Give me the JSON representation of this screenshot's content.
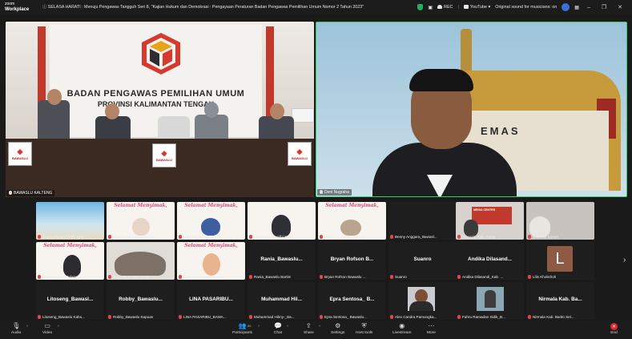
{
  "app": {
    "logo_line1": "zoom",
    "logo_line2": "Workplace"
  },
  "meeting": {
    "title": "SELASA HARATI : Menuju Pengawas Tangguh Seri 8, \"Kajian Hukum dan Demokrasi : Pengayaan Peraturan Badan Pengawas Pemilihan Umum Nomor 2 Tahun 2023\""
  },
  "status": {
    "rec": "REC",
    "youtube": "YouTube",
    "sound": "Original sound for musicians: on"
  },
  "colors": {
    "active_speaker": "#2fd36a",
    "end": "#e02828",
    "muted_mic": "#e04848"
  },
  "main": {
    "left_name": "BAWASLU KALTENG",
    "left_banner_line1": "BADAN PENGAWAS PEMILIHAN UMUM",
    "left_banner_line2": "PROVINSI KALIMANTAN TENGAH",
    "sign_label": "BAWASLU",
    "right_name": "Deni Nugraha",
    "right_sign": "EMAS"
  },
  "gallery": {
    "selamat_text": "Selamat Menyimak,",
    "row1": [
      {
        "name": "Satria BWSLU KAB. KPS"
      },
      {
        "name": "Misbah_Bws Kab. Barlim"
      },
      {
        "name": "B&S_BWS MURA"
      },
      {
        "name": "Bws Barsel_Ledhi Stan..."
      },
      {
        "name": "Terigo_Staf Bawaslu Ka..."
      },
      {
        "name": "Benny Anggara_Bawasl..."
      },
      {
        "name": "Bawaslu Kab. Kobar"
      },
      {
        "name": "Bawaslu Barsel"
      }
    ],
    "row2": [
      {
        "name": "Bawaslu Kota Palangka..."
      },
      {
        "name": "BAWASLU SERUYAN"
      },
      {
        "name": "Arum Dwi Gustarani_Ba..."
      },
      {
        "center": "Rania_Bawaslu...",
        "name": "Rania_Bawaslu Bartim"
      },
      {
        "center": "Bryan Rofson B...",
        "name": "Bryan Rofson Bawaslu ..."
      },
      {
        "center": "Suanro",
        "name": "Suanro"
      },
      {
        "center": "Andika  Dilasand...",
        "name": "Andika Dilasandi_Kab. ..."
      },
      {
        "letter": "L",
        "name": "Lilis Kholishoh"
      }
    ],
    "row3": [
      {
        "center": "Litoseng_Bawasl...",
        "name": "Litoseng_Bawaslu Kabu..."
      },
      {
        "center": "Robby_Bawaslu...",
        "name": "Robby_Bawaslu Kapuas"
      },
      {
        "center": "LINA PASARIBU...",
        "name": "LINA PASARIBU_BAWA..."
      },
      {
        "center": "Muhammad  Hil...",
        "name": "Muhammad Hilmy-_Ba..."
      },
      {
        "center": "Epra Sentosa_ B...",
        "name": "Epra Sentosa_ Bawaslu..."
      },
      {
        "name": "Alex Candra Pamungka..."
      },
      {
        "name": "Fahru Ramadan Sidik_B..."
      },
      {
        "center": "Nirmala Kab. Ba...",
        "name": "Nirmala Kab. Barito Sel..."
      }
    ],
    "media_center": "MEDIA CENTER"
  },
  "toolbar": {
    "audio": "Audio",
    "video": "Video",
    "participants": "Participants",
    "participants_count": "86",
    "chat": "Chat",
    "share": "Share",
    "settings": "Settings",
    "host_tools": "Host tools",
    "livestream": "Livestream",
    "more": "More",
    "end": "End"
  }
}
